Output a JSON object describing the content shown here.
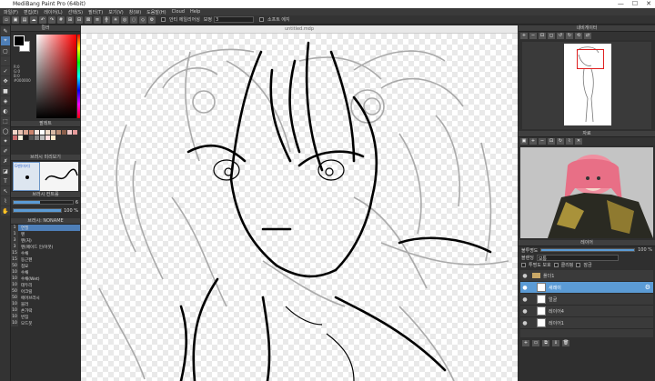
{
  "window": {
    "title": "MediBang Paint Pro (64bit)",
    "min": "—",
    "max": "☐",
    "close": "✕"
  },
  "menu": [
    "파일(F)",
    "편집(E)",
    "레이어(L)",
    "선택(S)",
    "필터(T)",
    "보기(V)",
    "창(W)",
    "도움말(H)",
    "Cloud",
    "Help"
  ],
  "toolbar": {
    "antialias_label": "안티 에일리어싱",
    "correction_label": "보정",
    "correction_value": "3",
    "softedge_label": "소프트 에지"
  },
  "left": {
    "color_title": "컬러",
    "color_info": [
      "R:0",
      "G:0",
      "B:0",
      "#000000"
    ],
    "palette_title": "팔레트",
    "palette_colors": [
      "#f2d6c9",
      "#e9c2b1",
      "#d9a48f",
      "#c9826c",
      "#f6e6de",
      "#ffffff",
      "#eedac8",
      "#d7b9a3",
      "#b88c73",
      "#8a5e4a",
      "#f0c8c8",
      "#e79b9b",
      "#c76a6a",
      "#f6f0dc",
      "#1a1a1a",
      "#555555",
      "#888888",
      "#bbbbbb",
      "#ffdddd",
      "#ffe9c9"
    ],
    "brushprev_title": "브러시 미리보기",
    "brush_name": "G펜(마키)",
    "brushctrl_title": "브러시 컨트롤",
    "size_value": "6",
    "opacity_value": "100 %",
    "size_fill": 0.45,
    "opacity_fill": 1.0,
    "brushlist_title": "브러시: NONAME",
    "brushes": [
      {
        "size": "1",
        "name": "연필"
      },
      {
        "size": "1",
        "name": "펜"
      },
      {
        "size": "3",
        "name": "펜(처)"
      },
      {
        "size": "3",
        "name": "펜(페이드 인/아웃)"
      },
      {
        "size": "15",
        "name": "수채"
      },
      {
        "size": "15",
        "name": "둥근펜"
      },
      {
        "size": "50",
        "name": "점묘"
      },
      {
        "size": "10",
        "name": "수채"
      },
      {
        "size": "10",
        "name": "수채(Wet)"
      },
      {
        "size": "10",
        "name": "데두리"
      },
      {
        "size": "50",
        "name": "아크릴"
      },
      {
        "size": "50",
        "name": "에어브러시"
      },
      {
        "size": "10",
        "name": "블러"
      },
      {
        "size": "10",
        "name": "손가락"
      },
      {
        "size": "10",
        "name": "번짐"
      },
      {
        "size": "10",
        "name": "모드붓"
      }
    ]
  },
  "canvas": {
    "tab_title": "untitled.mdp"
  },
  "right": {
    "navigator_title": "내비게이터",
    "reference_title": "자료",
    "layer_title": "레이어",
    "opacity_label": "불투명도",
    "opacity_value": "100 %",
    "blend_label": "블렌딩",
    "blend_value": "보통",
    "protect_label": "투명도 보호",
    "clip_label": "클리핑",
    "lock_label": "잠금",
    "layers": [
      {
        "name": "폴더1",
        "type": "folder",
        "selected": false
      },
      {
        "name": "새레이",
        "type": "layer",
        "selected": true
      },
      {
        "name": "얼굴",
        "type": "layer",
        "selected": false
      },
      {
        "name": "레이어4",
        "type": "layer",
        "selected": false
      },
      {
        "name": "레이어1",
        "type": "layer",
        "selected": false
      }
    ]
  }
}
